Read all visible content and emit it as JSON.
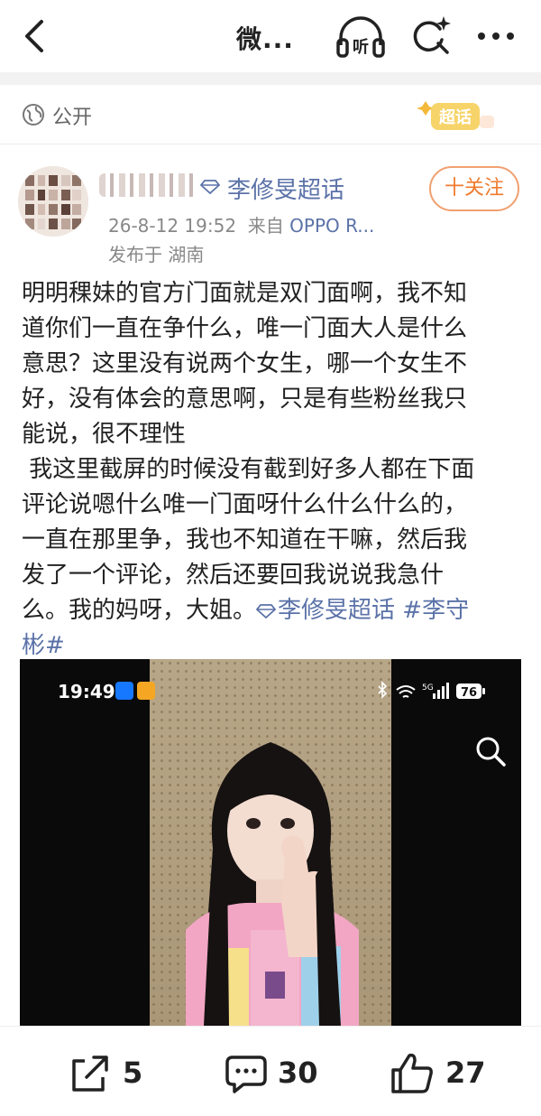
{
  "nav": {
    "title": "微...",
    "listen_label": "听"
  },
  "visibility": {
    "label": "公开",
    "super_badge": "超话"
  },
  "author": {
    "supertopic": "李修旻超话",
    "follow_label": "十关注",
    "timestamp": "26-8-12 19:52",
    "source_prefix": "来自",
    "source": "OPPO R...",
    "location": "发布于 湖南"
  },
  "post": {
    "lines": [
      "明明稞妹的官方门面就是双门面啊，我不知",
      "道你们一直在争什么，唯一门面大人是什么",
      "意思？这里没有说两个女生，哪一个女生不",
      "好，没有体会的意思啊，只是有些粉丝我只",
      "能说，很不理性",
      " 我这里截屏的时候没有截到好多人都在下面",
      "评论说嗯什么唯一门面呀什么什么什么的，",
      "一直在那里争，我也不知道在干嘛，然后我",
      "发了一个评论，然后还要回我说说我急什"
    ],
    "last_line_text": "么。我的妈呀，大姐。",
    "topic_link": "李修旻超话",
    "hashtag_part1": "#李守",
    "hashtag_part2": "彬#"
  },
  "image": {
    "status_time": "19:49",
    "battery": "76",
    "network": "5G"
  },
  "actions": {
    "share_count": "5",
    "comment_count": "30",
    "like_count": "27"
  },
  "colors": {
    "link": "#5b72a8",
    "follow_accent": "#f07a2c",
    "badge_gold": "#f4c24a"
  }
}
